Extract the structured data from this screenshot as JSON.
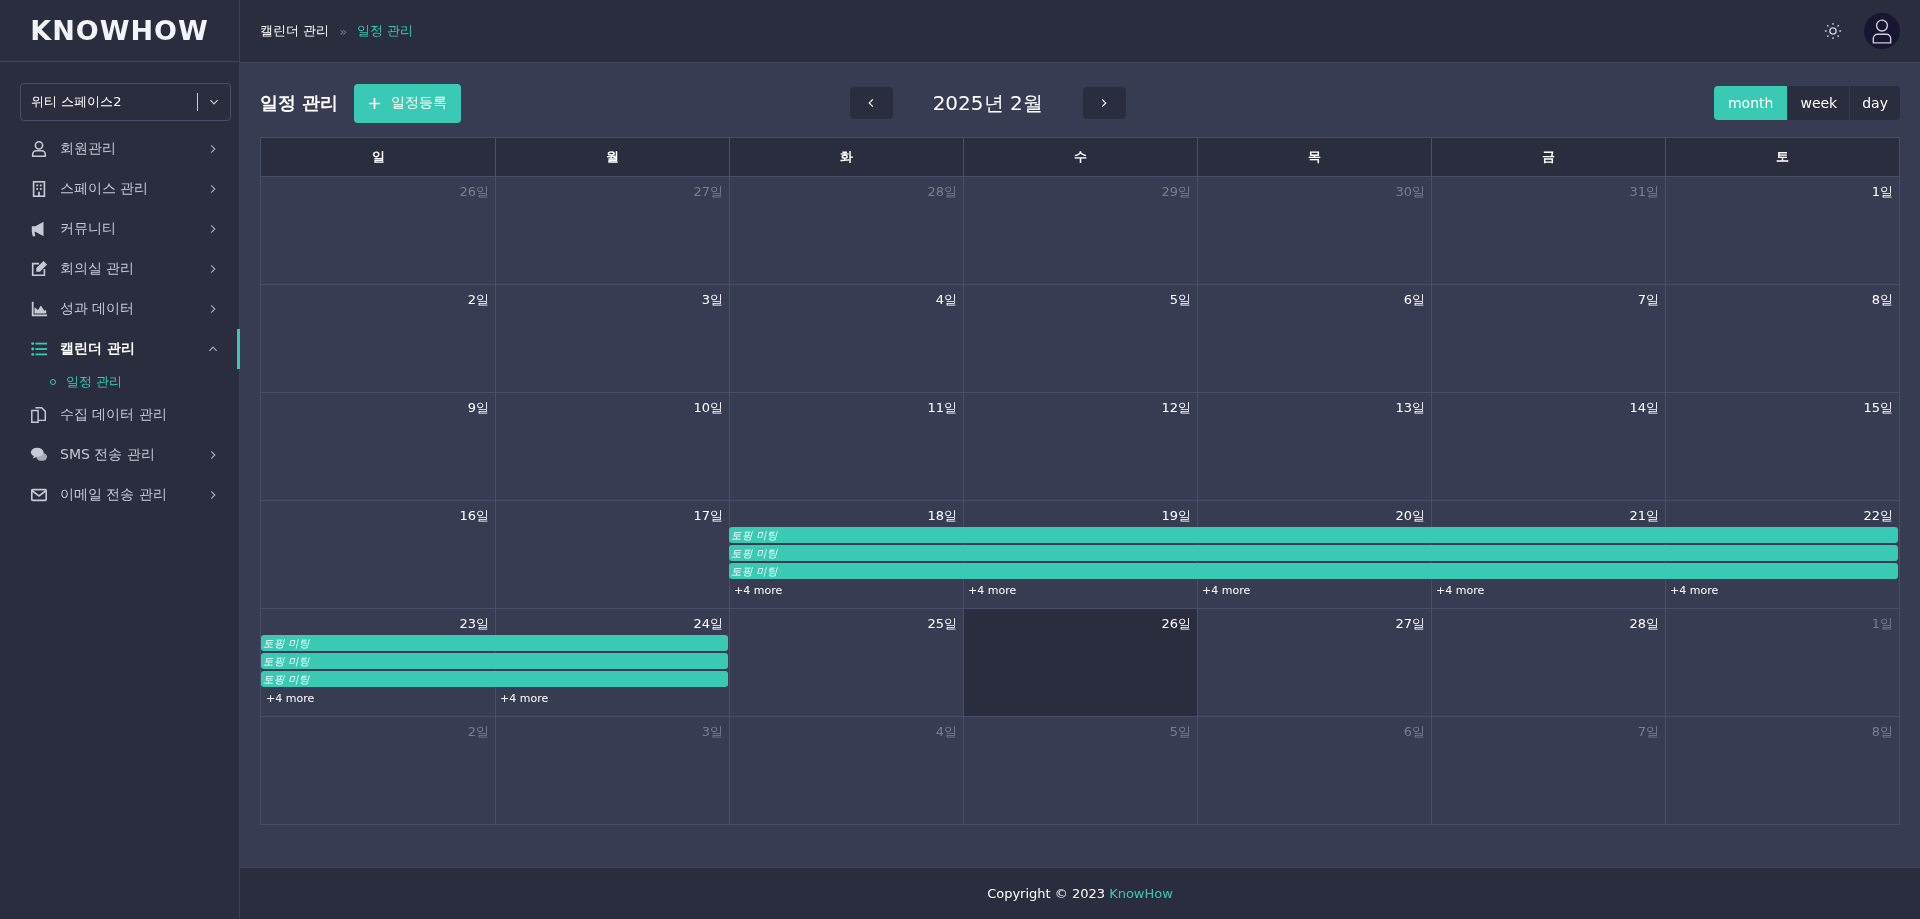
{
  "sidebar": {
    "logo": "KNOWHOW",
    "workspace": {
      "value": "위티 스페이스2"
    },
    "items": [
      {
        "label": "회원관리",
        "expanded": false,
        "selected": false
      },
      {
        "label": "스페이스 관리",
        "expanded": false,
        "selected": false
      },
      {
        "label": "커뮤니티",
        "expanded": false,
        "selected": false
      },
      {
        "label": "회의실 관리",
        "expanded": false,
        "selected": false
      },
      {
        "label": "성과 데이터",
        "expanded": false,
        "selected": false
      },
      {
        "label": "캘린더 관리",
        "expanded": true,
        "selected": true,
        "children": [
          {
            "label": "일정 관리",
            "selected": true
          }
        ]
      },
      {
        "label": "수집 데이터 관리",
        "selected": false
      },
      {
        "label": "SMS 전송 관리",
        "expanded": false,
        "selected": false
      },
      {
        "label": "이메일 전송 관리",
        "expanded": false,
        "selected": false
      }
    ]
  },
  "header": {
    "breadcrumbs": [
      "캘린더 관리",
      "일정 관리"
    ],
    "separator": "»"
  },
  "toolbar": {
    "title": "일정 관리",
    "add_button": "일정등록",
    "month_label": "2025년 2월",
    "views": [
      {
        "label": "month",
        "selected": true
      },
      {
        "label": "week",
        "selected": false
      },
      {
        "label": "day",
        "selected": false
      }
    ]
  },
  "calendar": {
    "weekdays": [
      "일",
      "월",
      "화",
      "수",
      "목",
      "금",
      "토"
    ],
    "weeks": [
      {
        "days": [
          {
            "label": "26일",
            "muted": true,
            "today": false
          },
          {
            "label": "27일",
            "muted": true,
            "today": false
          },
          {
            "label": "28일",
            "muted": true,
            "today": false
          },
          {
            "label": "29일",
            "muted": true,
            "today": false
          },
          {
            "label": "30일",
            "muted": true,
            "today": false
          },
          {
            "label": "31일",
            "muted": true,
            "today": false
          },
          {
            "label": "1일",
            "muted": false,
            "today": false
          }
        ]
      },
      {
        "days": [
          {
            "label": "2일",
            "muted": false,
            "today": false
          },
          {
            "label": "3일",
            "muted": false,
            "today": false
          },
          {
            "label": "4일",
            "muted": false,
            "today": false
          },
          {
            "label": "5일",
            "muted": false,
            "today": false
          },
          {
            "label": "6일",
            "muted": false,
            "today": false
          },
          {
            "label": "7일",
            "muted": false,
            "today": false
          },
          {
            "label": "8일",
            "muted": false,
            "today": false
          }
        ]
      },
      {
        "days": [
          {
            "label": "9일",
            "muted": false,
            "today": false
          },
          {
            "label": "10일",
            "muted": false,
            "today": false
          },
          {
            "label": "11일",
            "muted": false,
            "today": false
          },
          {
            "label": "12일",
            "muted": false,
            "today": false
          },
          {
            "label": "13일",
            "muted": false,
            "today": false
          },
          {
            "label": "14일",
            "muted": false,
            "today": false
          },
          {
            "label": "15일",
            "muted": false,
            "today": false
          }
        ]
      },
      {
        "days": [
          {
            "label": "16일",
            "muted": false,
            "today": false
          },
          {
            "label": "17일",
            "muted": false,
            "today": false
          },
          {
            "label": "18일",
            "muted": false,
            "today": false,
            "events": [
              {
                "kind": "start",
                "title": "토핑 미팅"
              },
              {
                "kind": "start",
                "title": "토핑 미팅"
              },
              {
                "kind": "start",
                "title": "토핑 미팅"
              }
            ],
            "more": "+4 more"
          },
          {
            "label": "19일",
            "muted": false,
            "today": false,
            "events": [
              {
                "kind": "continue"
              },
              {
                "kind": "continue"
              },
              {
                "kind": "continue"
              }
            ],
            "more": "+4 more"
          },
          {
            "label": "20일",
            "muted": false,
            "today": false,
            "events": [
              {
                "kind": "continue"
              },
              {
                "kind": "continue"
              },
              {
                "kind": "continue"
              }
            ],
            "more": "+4 more"
          },
          {
            "label": "21일",
            "muted": false,
            "today": false,
            "events": [
              {
                "kind": "continue"
              },
              {
                "kind": "continue"
              },
              {
                "kind": "continue"
              }
            ],
            "more": "+4 more"
          },
          {
            "label": "22일",
            "muted": false,
            "today": false,
            "events": [
              {
                "kind": "continue"
              },
              {
                "kind": "continue"
              },
              {
                "kind": "continue"
              }
            ],
            "more": "+4 more"
          }
        ]
      },
      {
        "days": [
          {
            "label": "23일",
            "muted": false,
            "today": false,
            "events": [
              {
                "kind": "start",
                "title": "토핑 미팅"
              },
              {
                "kind": "start",
                "title": "토핑 미팅"
              },
              {
                "kind": "start",
                "title": "토핑 미팅"
              }
            ],
            "more": "+4 more"
          },
          {
            "label": "24일",
            "muted": false,
            "today": false,
            "events": [
              {
                "kind": "continue"
              },
              {
                "kind": "continue"
              },
              {
                "kind": "continue"
              }
            ],
            "more": "+4 more"
          },
          {
            "label": "25일",
            "muted": false,
            "today": false
          },
          {
            "label": "26일",
            "muted": false,
            "today": true
          },
          {
            "label": "27일",
            "muted": false,
            "today": false
          },
          {
            "label": "28일",
            "muted": false,
            "today": false
          },
          {
            "label": "1일",
            "muted": true,
            "today": false
          }
        ]
      },
      {
        "days": [
          {
            "label": "2일",
            "muted": true,
            "today": false
          },
          {
            "label": "3일",
            "muted": true,
            "today": false
          },
          {
            "label": "4일",
            "muted": true,
            "today": false
          },
          {
            "label": "5일",
            "muted": true,
            "today": false
          },
          {
            "label": "6일",
            "muted": true,
            "today": false
          },
          {
            "label": "7일",
            "muted": true,
            "today": false
          },
          {
            "label": "8일",
            "muted": true,
            "today": false
          }
        ]
      }
    ]
  },
  "footer": {
    "text": "Copyright © 2023",
    "link": "KnowHow"
  }
}
